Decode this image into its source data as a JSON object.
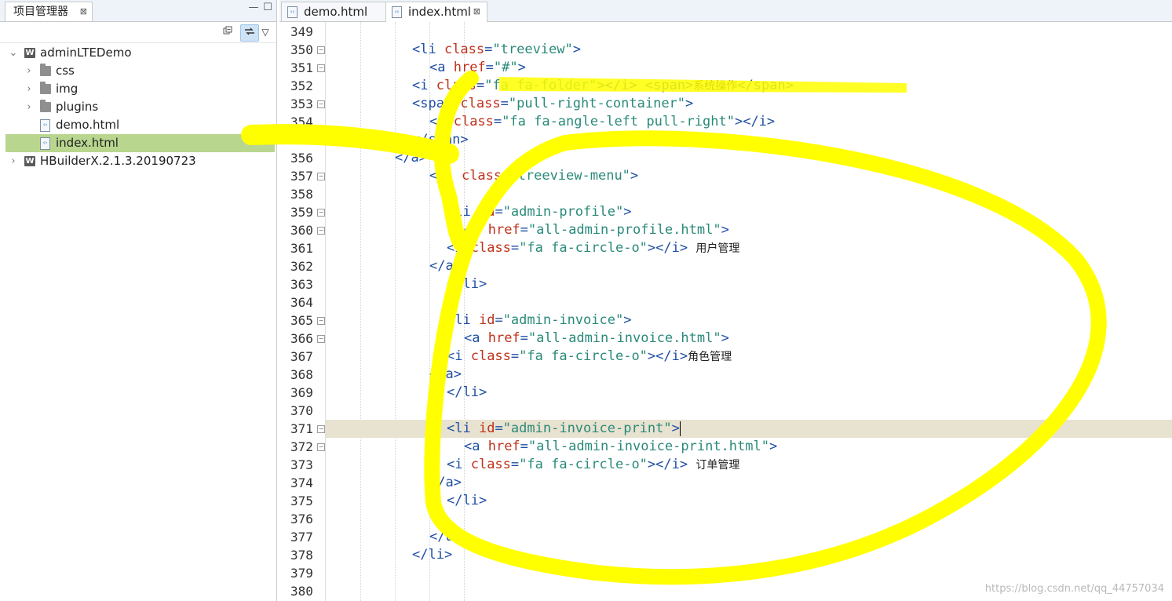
{
  "left_panel": {
    "tab_label": "项目管理器",
    "close_glyph": "⊠",
    "minimize_glyph": "—",
    "maximize_glyph": "☐",
    "toolbar": {
      "collapse_icon": "collapse-all-icon",
      "link_icon": "link-with-editor-icon",
      "menu_glyph": "▽"
    },
    "tree": [
      {
        "label": "adminLTEDemo",
        "kind": "project",
        "expanded": true,
        "level": 0
      },
      {
        "label": "css",
        "kind": "folder",
        "expanded": false,
        "level": 1
      },
      {
        "label": "img",
        "kind": "folder",
        "expanded": false,
        "level": 1
      },
      {
        "label": "plugins",
        "kind": "folder",
        "expanded": false,
        "level": 1
      },
      {
        "label": "demo.html",
        "kind": "file",
        "level": 1
      },
      {
        "label": "index.html",
        "kind": "file",
        "level": 1,
        "selected": true
      },
      {
        "label": "HBuilderX.2.1.3.20190723",
        "kind": "project",
        "expanded": false,
        "level": 0
      }
    ]
  },
  "editor": {
    "tabs": [
      {
        "label": "demo.html",
        "active": false
      },
      {
        "label": "index.html",
        "active": true,
        "close_glyph": "⊠"
      }
    ],
    "current_line": "371",
    "lines": [
      {
        "n": "349",
        "fold": false,
        "indent": 0,
        "parts": []
      },
      {
        "n": "350",
        "fold": true,
        "indent": 5,
        "parts": [
          [
            "tag",
            "<li "
          ],
          [
            "attr",
            "class"
          ],
          [
            "tag",
            "="
          ],
          [
            "str",
            "\"treeview\""
          ],
          [
            "tag",
            ">"
          ]
        ]
      },
      {
        "n": "351",
        "fold": true,
        "indent": 6,
        "parts": [
          [
            "tag",
            "<a "
          ],
          [
            "attr",
            "href"
          ],
          [
            "tag",
            "="
          ],
          [
            "str",
            "\"#\""
          ],
          [
            "tag",
            ">"
          ]
        ]
      },
      {
        "n": "352",
        "fold": false,
        "indent": 5,
        "parts": [
          [
            "tag",
            "<i "
          ],
          [
            "attr",
            "class"
          ],
          [
            "tag",
            "="
          ],
          [
            "str",
            "\"fa fa-folder\""
          ],
          [
            "tag",
            "></i> <span>"
          ],
          [
            "txt",
            "系统操作"
          ],
          [
            "tag",
            "</span>"
          ]
        ]
      },
      {
        "n": "353",
        "fold": true,
        "indent": 5,
        "parts": [
          [
            "tag",
            "<span "
          ],
          [
            "attr",
            "class"
          ],
          [
            "tag",
            "="
          ],
          [
            "str",
            "\"pull-right-container\""
          ],
          [
            "tag",
            ">"
          ]
        ]
      },
      {
        "n": "354",
        "fold": false,
        "indent": 6,
        "parts": [
          [
            "tag",
            "<i "
          ],
          [
            "attr",
            "class"
          ],
          [
            "tag",
            "="
          ],
          [
            "str",
            "\"fa fa-angle-left pull-right\""
          ],
          [
            "tag",
            "></i>"
          ]
        ]
      },
      {
        "n": "355",
        "fold": false,
        "indent": 5,
        "parts": [
          [
            "tag",
            "</span>"
          ]
        ]
      },
      {
        "n": "356",
        "fold": false,
        "indent": 4,
        "parts": [
          [
            "tag",
            "</a>"
          ]
        ]
      },
      {
        "n": "357",
        "fold": true,
        "indent": 6,
        "parts": [
          [
            "tag",
            "<ul "
          ],
          [
            "attr",
            "class"
          ],
          [
            "tag",
            "="
          ],
          [
            "str",
            "\"treeview-menu\""
          ],
          [
            "tag",
            ">"
          ]
        ]
      },
      {
        "n": "358",
        "fold": false,
        "indent": 0,
        "parts": []
      },
      {
        "n": "359",
        "fold": true,
        "indent": 7,
        "parts": [
          [
            "tag",
            "<li "
          ],
          [
            "attr",
            "id"
          ],
          [
            "tag",
            "="
          ],
          [
            "str",
            "\"admin-profile\""
          ],
          [
            "tag",
            ">"
          ]
        ]
      },
      {
        "n": "360",
        "fold": true,
        "indent": 8,
        "parts": [
          [
            "tag",
            "<a "
          ],
          [
            "attr",
            "href"
          ],
          [
            "tag",
            "="
          ],
          [
            "str",
            "\"all-admin-profile.html\""
          ],
          [
            "tag",
            ">"
          ]
        ]
      },
      {
        "n": "361",
        "fold": false,
        "indent": 7,
        "parts": [
          [
            "tag",
            "<i "
          ],
          [
            "attr",
            "class"
          ],
          [
            "tag",
            "="
          ],
          [
            "str",
            "\"fa fa-circle-o\""
          ],
          [
            "tag",
            "></i> "
          ],
          [
            "txt",
            "用户管理"
          ]
        ]
      },
      {
        "n": "362",
        "fold": false,
        "indent": 6,
        "parts": [
          [
            "tag",
            "</a>"
          ]
        ]
      },
      {
        "n": "363",
        "fold": false,
        "indent": 7,
        "parts": [
          [
            "tag",
            "</li>"
          ]
        ]
      },
      {
        "n": "364",
        "fold": false,
        "indent": 0,
        "parts": []
      },
      {
        "n": "365",
        "fold": true,
        "indent": 7,
        "parts": [
          [
            "tag",
            "<li "
          ],
          [
            "attr",
            "id"
          ],
          [
            "tag",
            "="
          ],
          [
            "str",
            "\"admin-invoice\""
          ],
          [
            "tag",
            ">"
          ]
        ]
      },
      {
        "n": "366",
        "fold": true,
        "indent": 8,
        "parts": [
          [
            "tag",
            "<a "
          ],
          [
            "attr",
            "href"
          ],
          [
            "tag",
            "="
          ],
          [
            "str",
            "\"all-admin-invoice.html\""
          ],
          [
            "tag",
            ">"
          ]
        ]
      },
      {
        "n": "367",
        "fold": false,
        "indent": 7,
        "parts": [
          [
            "tag",
            "<i "
          ],
          [
            "attr",
            "class"
          ],
          [
            "tag",
            "="
          ],
          [
            "str",
            "\"fa fa-circle-o\""
          ],
          [
            "tag",
            "></i>"
          ],
          [
            "txt",
            "角色管理"
          ]
        ]
      },
      {
        "n": "368",
        "fold": false,
        "indent": 6,
        "parts": [
          [
            "tag",
            "</a>"
          ]
        ]
      },
      {
        "n": "369",
        "fold": false,
        "indent": 7,
        "parts": [
          [
            "tag",
            "</li>"
          ]
        ]
      },
      {
        "n": "370",
        "fold": false,
        "indent": 0,
        "parts": []
      },
      {
        "n": "371",
        "fold": true,
        "indent": 7,
        "parts": [
          [
            "tag",
            "<li "
          ],
          [
            "attr",
            "id"
          ],
          [
            "tag",
            "="
          ],
          [
            "str",
            "\"admin-invoice-print\""
          ],
          [
            "tag",
            ">"
          ]
        ]
      },
      {
        "n": "372",
        "fold": true,
        "indent": 8,
        "parts": [
          [
            "tag",
            "<a "
          ],
          [
            "attr",
            "href"
          ],
          [
            "tag",
            "="
          ],
          [
            "str",
            "\"all-admin-invoice-print.html\""
          ],
          [
            "tag",
            ">"
          ]
        ]
      },
      {
        "n": "373",
        "fold": false,
        "indent": 7,
        "parts": [
          [
            "tag",
            "<i "
          ],
          [
            "attr",
            "class"
          ],
          [
            "tag",
            "="
          ],
          [
            "str",
            "\"fa fa-circle-o\""
          ],
          [
            "tag",
            "></i> "
          ],
          [
            "txt",
            "订单管理"
          ]
        ]
      },
      {
        "n": "374",
        "fold": false,
        "indent": 6,
        "parts": [
          [
            "tag",
            "</a>"
          ]
        ]
      },
      {
        "n": "375",
        "fold": false,
        "indent": 7,
        "parts": [
          [
            "tag",
            "</li>"
          ]
        ]
      },
      {
        "n": "376",
        "fold": false,
        "indent": 0,
        "parts": []
      },
      {
        "n": "377",
        "fold": false,
        "indent": 6,
        "parts": [
          [
            "tag",
            "</ul>"
          ]
        ]
      },
      {
        "n": "378",
        "fold": false,
        "indent": 5,
        "parts": [
          [
            "tag",
            "</li>"
          ]
        ]
      },
      {
        "n": "379",
        "fold": false,
        "indent": 0,
        "parts": []
      },
      {
        "n": "380",
        "fold": false,
        "indent": 0,
        "parts": []
      }
    ]
  },
  "colors": {
    "tag": "#1f4fa5",
    "attribute": "#c0321b",
    "string": "#2a8a7a",
    "selection": "#b9d68f",
    "current_line": "#e8e2d0",
    "annotation": "#ffff00"
  },
  "watermark": "https://blog.csdn.net/qq_44757034"
}
